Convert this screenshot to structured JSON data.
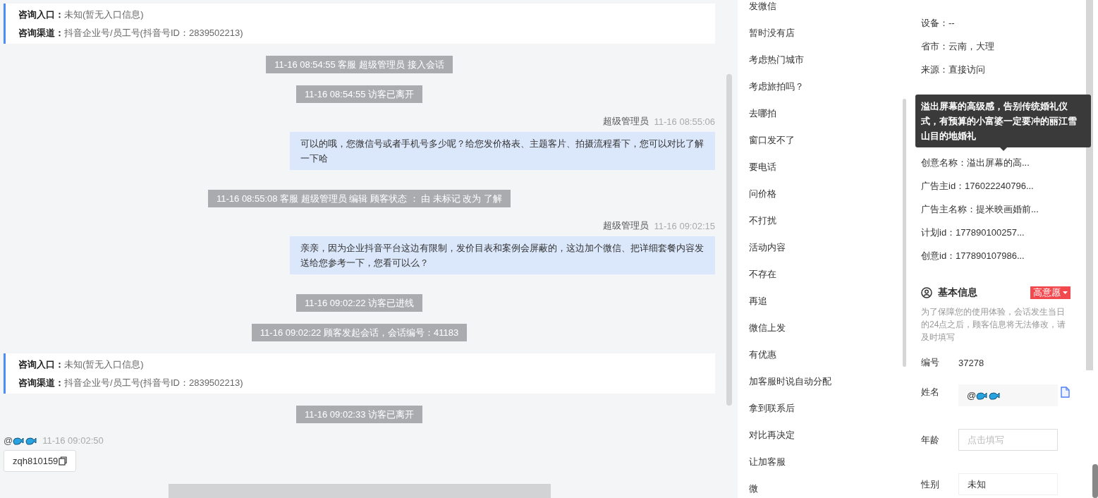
{
  "chat": {
    "items": [
      {
        "kind": "info",
        "rows": [
          {
            "label": "咨询入口：",
            "value": "未知(暂无入口信息)"
          },
          {
            "label": "咨询渠道：",
            "value": "抖音企业号/员工号(抖音号ID：2839502213)"
          }
        ]
      },
      {
        "kind": "system",
        "text": "11-16 08:54:55 客服 超级管理员 接入会话"
      },
      {
        "kind": "system",
        "text": "11-16 08:54:55 访客已离开"
      },
      {
        "kind": "agent",
        "name": "超级管理员",
        "time": "11-16 08:55:06",
        "text": "可以的哦，您微信号或者手机号多少呢？给您发价格表、主题客片、拍摄流程看下，您可以对比了解一下哈"
      },
      {
        "kind": "system",
        "text": "11-16 08:55:08 客服 超级管理员 编辑 顾客状态 ： 由 未标记 改为 了解"
      },
      {
        "kind": "agent",
        "name": "超级管理员",
        "time": "11-16 09:02:15",
        "text": "亲亲，因为企业抖音平台这边有限制，发价目表和案例会屏蔽的，这边加个微信、把详细套餐内容发送给您参考一下，您看可以么？"
      },
      {
        "kind": "system",
        "text": "11-16 09:02:22 访客已进线"
      },
      {
        "kind": "system",
        "text": "11-16 09:02:22 顾客发起会话，会话编号：41183"
      },
      {
        "kind": "info",
        "rows": [
          {
            "label": "咨询入口：",
            "value": "未知(暂无入口信息)"
          },
          {
            "label": "咨询渠道：",
            "value": "抖音企业号/员工号(抖音号ID：2839502213)"
          }
        ]
      },
      {
        "kind": "system",
        "text": "11-16 09:02:33 访客已离开"
      },
      {
        "kind": "visitor",
        "name": "@",
        "time": "11-16 09:02:50",
        "text": "zqh810159"
      },
      {
        "kind": "system_cut"
      }
    ]
  },
  "quick_replies": [
    "发微信",
    "暂时没有店",
    "考虑热门城市",
    "考虑旅拍吗？",
    "去哪拍",
    "窗口发不了",
    "要电话",
    "问价格",
    "不打扰",
    "活动内容",
    "不存在",
    "再追",
    "微信上发",
    "有优惠",
    "加客服时说自动分配",
    "拿到联系后",
    "对比再决定",
    "让加客服",
    "微"
  ],
  "visitor_info": {
    "rows": [
      "设备：--",
      "省市：云南，大理",
      "来源：直接访问",
      null,
      null,
      null,
      "创意名称：溢出屏幕的高...",
      "广告主id：176022240796...",
      "广告主名称：提米映画婚前...",
      "计划id：177890100257...",
      "创意id：177890107986..."
    ],
    "tooltip": "溢出屏幕的高级感，告别传统婚礼仪式，有预算的小富婆一定要冲的丽江雪山目的地婚礼"
  },
  "basic_info": {
    "title": "基本信息",
    "intent": "高意愿",
    "note": "为了保障您的使用体验，会话发生当日的24点之后，顾客信息将无法修改，请及时填写",
    "fields": [
      {
        "label": "编号",
        "kind": "text",
        "value": "37278"
      },
      {
        "label": "姓名",
        "kind": "name",
        "value": "@"
      },
      {
        "label": "年龄",
        "kind": "input",
        "placeholder": "点击填写"
      },
      {
        "label": "性别",
        "kind": "select",
        "value": "未知"
      }
    ]
  }
}
